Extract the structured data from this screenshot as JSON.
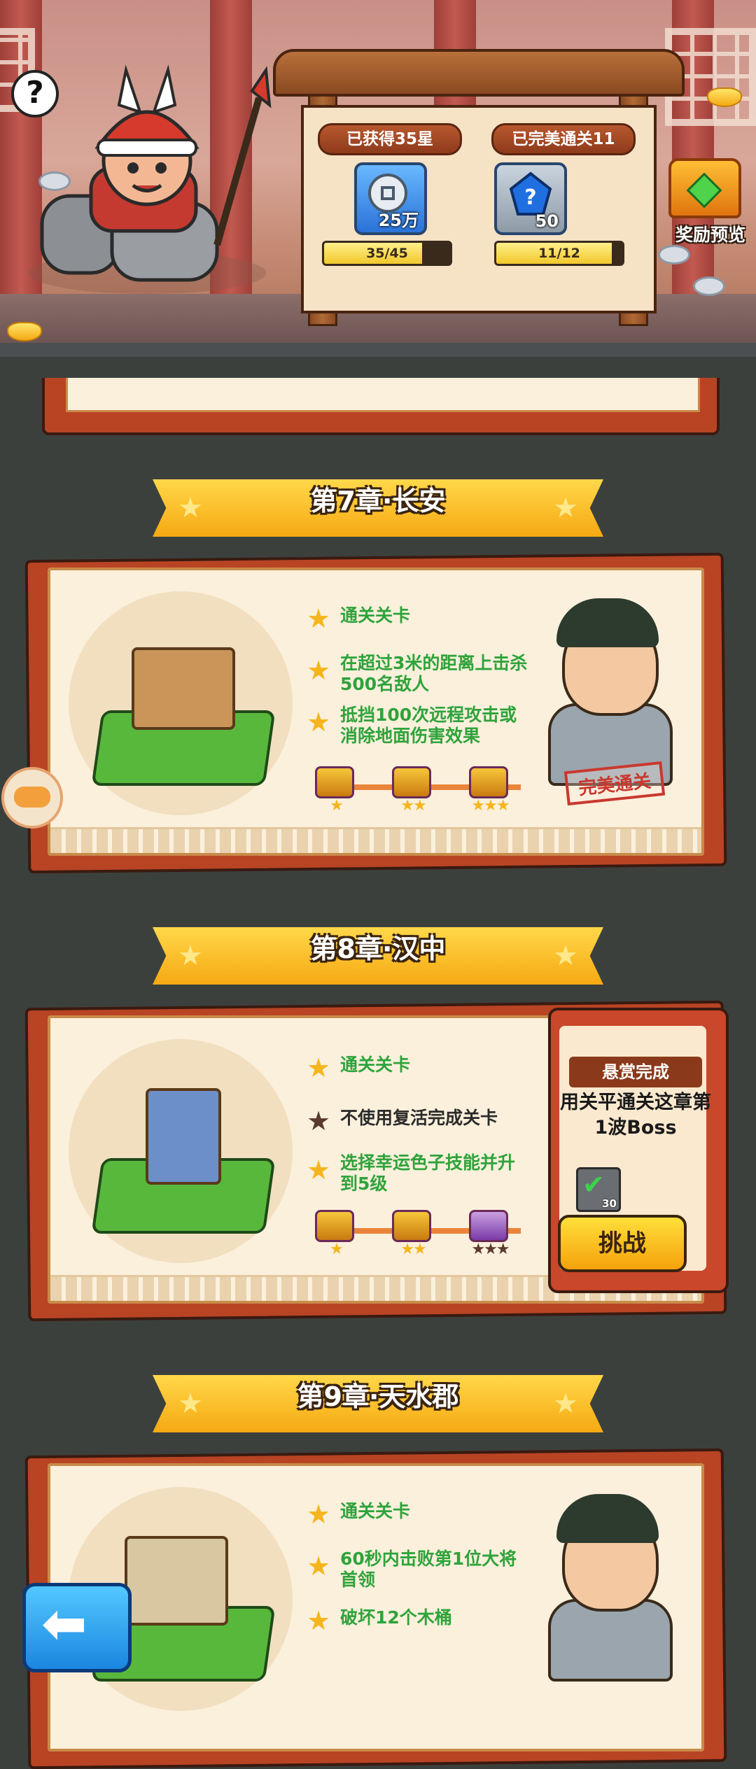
{
  "header": {
    "help_label": "?",
    "stars_earned_label": "已获得35星",
    "perfect_clear_label": "已完美通关11",
    "stars_reward_amount": "25万",
    "perfect_reward_amount": "50",
    "stars_progress_text": "35/45",
    "stars_progress_value": 0.778,
    "perfect_progress_text": "11/12",
    "perfect_progress_value": 0.917,
    "reward_preview_label": "奖励预览"
  },
  "chapters": [
    {
      "title": "第7章·长安",
      "tasks": [
        {
          "text": "通关关卡",
          "done": true
        },
        {
          "text": "在超过3米的距离上击杀500名敌人",
          "done": true
        },
        {
          "text": "抵挡100次远程攻击或消除地面伤害效果",
          "done": true
        }
      ],
      "milestone_stars": [
        1,
        2,
        3
      ],
      "stamp": "完美通关"
    },
    {
      "title": "第8章·汉中",
      "tasks": [
        {
          "text": "通关关卡",
          "done": true
        },
        {
          "text": "不使用复活完成关卡",
          "done": false
        },
        {
          "text": "选择幸运色子技能并升到5级",
          "done": true
        }
      ],
      "milestone_stars": [
        1,
        2,
        3
      ],
      "bounty": {
        "tag": "悬赏完成",
        "text": "用关平通关这章第1波Boss",
        "reward_count": "30",
        "button": "挑战"
      }
    },
    {
      "title": "第9章·天水郡",
      "tasks": [
        {
          "text": "通关关卡",
          "done": true
        },
        {
          "text": "60秒内击败第1位大将首领",
          "done": true
        },
        {
          "text": "破坏12个木桶",
          "done": true
        }
      ]
    }
  ],
  "icons": {
    "star_done_color": "#f5b51c",
    "star_todo_color": "#5a3a2a",
    "accent_yellow": "#ffd84a",
    "frame_red": "#b84424"
  }
}
